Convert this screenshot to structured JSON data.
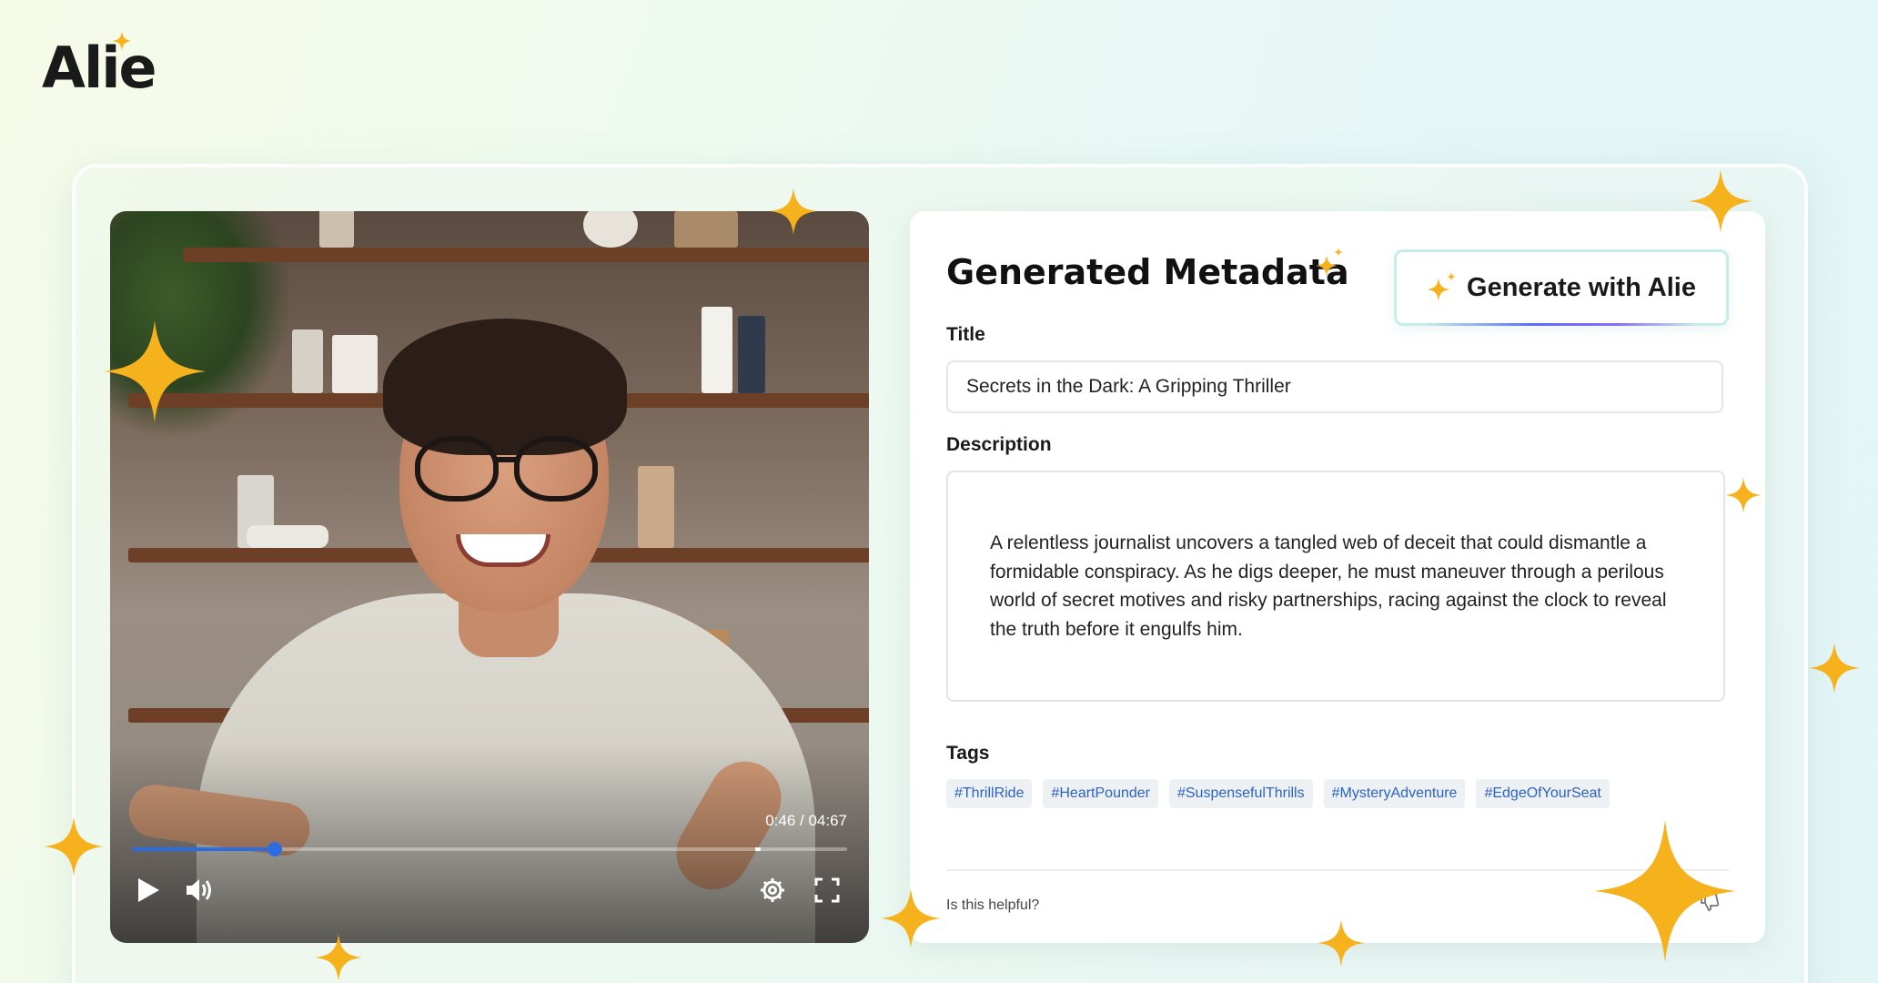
{
  "brand": {
    "logo_text": "Alie",
    "accent": "#f6b21d"
  },
  "video": {
    "time_display": "0:46 / 04:67",
    "progress": 0.2,
    "buffered_marker": 0.86,
    "controls": [
      "play-icon",
      "volume-icon",
      "settings-icon",
      "fullscreen-icon"
    ]
  },
  "metadata": {
    "heading": "Generated Metadata",
    "generate_button": "Generate with Alie",
    "title_label": "Title",
    "title_value": "Secrets in the Dark: A Gripping Thriller",
    "description_label": "Description",
    "description_value": "A relentless journalist uncovers a tangled web of deceit that could dismantle a formidable conspiracy. As he digs deeper, he must maneuver through a perilous world of secret motives and risky partnerships, racing against the clock to reveal the truth before it engulfs him.",
    "tags_label": "Tags",
    "tags": [
      "#ThrillRide",
      "#HeartPounder",
      "#SuspensefulThrills",
      "#MysteryAdventure",
      "#EdgeOfYourSeat"
    ],
    "feedback_prompt": "Is this helpful?"
  }
}
